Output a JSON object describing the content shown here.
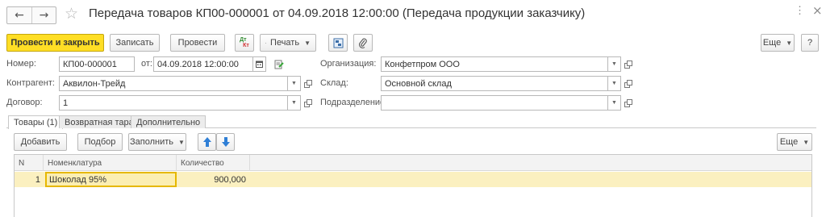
{
  "window": {
    "title": "Передача товаров КП00-000001 от 04.09.2018 12:00:00 (Передача продукции заказчику)",
    "more_glyph": "⋮",
    "close_glyph": "×"
  },
  "nav": {
    "back": "←",
    "forward": "→"
  },
  "star_glyph": "☆",
  "toolbar": {
    "post_close": "Провести и закрыть",
    "save": "Записать",
    "post": "Провести",
    "print": "Печать",
    "more": "Еще",
    "help": "?",
    "dtkt_top": "Дт",
    "dtkt_bottom": "Кт"
  },
  "form": {
    "number_label": "Номер:",
    "number_value": "КП00-000001",
    "date_label": "от:",
    "date_value": "04.09.2018 12:00:00",
    "counterparty_label": "Контрагент:",
    "counterparty_value": "Аквилон-Трейд",
    "contract_label": "Договор:",
    "contract_value": "1",
    "organization_label": "Организация:",
    "organization_value": "Конфетпром ООО",
    "warehouse_label": "Склад:",
    "warehouse_value": "Основной склад",
    "department_label": "Подразделение:",
    "department_value": ""
  },
  "tabs": [
    {
      "label": "Товары (1)"
    },
    {
      "label": "Возвратная тара"
    },
    {
      "label": "Дополнительно"
    }
  ],
  "goods_toolbar": {
    "add": "Добавить",
    "pick": "Подбор",
    "fill": "Заполнить",
    "more": "Еще"
  },
  "table": {
    "headers": {
      "n": "N",
      "item": "Номенклатура",
      "qty": "Количество"
    },
    "rows": [
      {
        "n": "1",
        "item": "Шоколад 95%",
        "qty": "900,000"
      }
    ]
  },
  "colors": {
    "primary_button": "#ffde25",
    "selected_row": "#fbf0c0",
    "selected_cell_border": "#e6b800",
    "arrow_blue": "#2f7fd6"
  }
}
